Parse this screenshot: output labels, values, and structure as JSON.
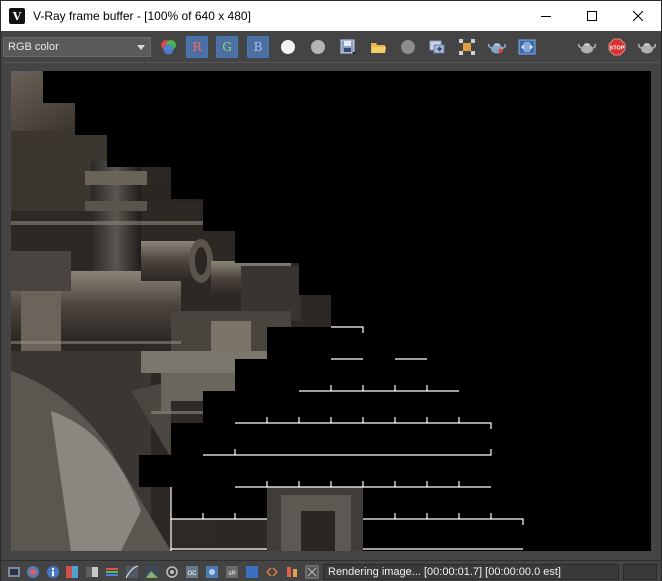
{
  "window": {
    "title": "V-Ray frame buffer - [100% of 640 x 480]",
    "app_icon_glyph": "V"
  },
  "toolbar": {
    "channel_select": {
      "value": "RGB color"
    },
    "channel_buttons": {
      "r": "R",
      "g": "G",
      "b": "B"
    },
    "icons": [
      "color-channels-icon",
      "r-channel-button",
      "g-channel-button",
      "b-channel-button",
      "white-dot-icon",
      "gray-dot-icon",
      "save-image-icon",
      "open-image-icon",
      "clear-image-icon",
      "duplicate-icon",
      "region-render-icon",
      "teapot-icon",
      "lens-effects-icon",
      "teapot-render-icon",
      "stop-render-icon",
      "teapot-last-icon"
    ],
    "stop_label": "STOP"
  },
  "render": {
    "width": 640,
    "height": 480
  },
  "statusbar": {
    "status_text": "Rendering image... [00:00:01.7] [00:00:00.0 est]"
  },
  "colors": {
    "background": "#444444",
    "accent": "#3e78c8",
    "titlebar": "#ffffff"
  }
}
